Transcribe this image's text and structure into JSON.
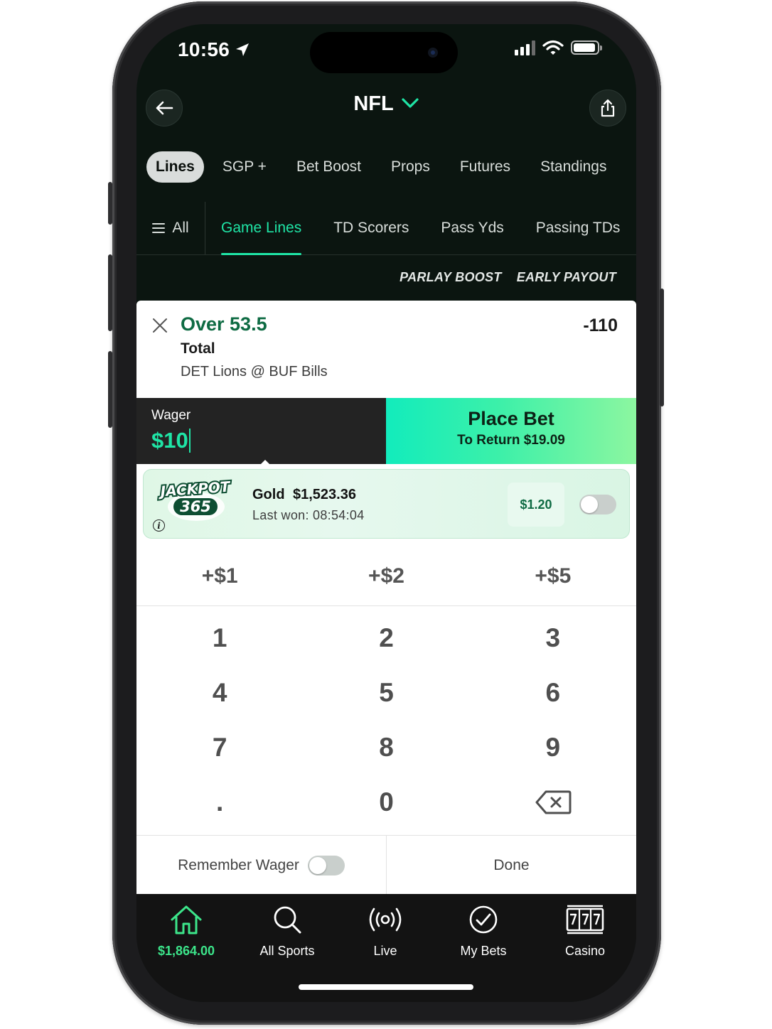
{
  "status": {
    "time": "10:56"
  },
  "header": {
    "title": "NFL"
  },
  "top_tabs": [
    {
      "label": "Lines",
      "active": true
    },
    {
      "label": "SGP +"
    },
    {
      "label": "Bet Boost"
    },
    {
      "label": "Props"
    },
    {
      "label": "Futures"
    },
    {
      "label": "Standings"
    }
  ],
  "sub_tabs": {
    "all": "All",
    "items": [
      {
        "label": "Game Lines",
        "active": true
      },
      {
        "label": "TD Scorers"
      },
      {
        "label": "Pass Yds"
      },
      {
        "label": "Passing TDs"
      }
    ]
  },
  "promos": [
    "PARLAY BOOST",
    "EARLY PAYOUT"
  ],
  "bet": {
    "selection": "Over 53.5",
    "odds": "-110",
    "market": "Total",
    "event": "DET Lions @ BUF Bills"
  },
  "wager": {
    "label": "Wager",
    "amount": "$10"
  },
  "place_bet": {
    "title": "Place Bet",
    "return": "To Return $19.09"
  },
  "jackpot": {
    "logo_text_top": "JACKPOT",
    "logo_text_bottom": "365",
    "tier": "Gold",
    "amount": "$1,523.36",
    "last_won": "Last won: 08:54:04",
    "price": "$1.20",
    "enabled": false
  },
  "quick_add": [
    "+$1",
    "+$2",
    "+$5"
  ],
  "keypad": [
    [
      "1",
      "2",
      "3"
    ],
    [
      "4",
      "5",
      "6"
    ],
    [
      "7",
      "8",
      "9"
    ],
    [
      ".",
      "0",
      "backspace-icon"
    ]
  ],
  "remember_wager": {
    "label": "Remember Wager",
    "enabled": false
  },
  "done_label": "Done",
  "tab_bar": [
    {
      "label": "$1,864.00",
      "icon": "home-icon",
      "active": true
    },
    {
      "label": "All Sports",
      "icon": "search-icon"
    },
    {
      "label": "Live",
      "icon": "live-broadcast-icon"
    },
    {
      "label": "My Bets",
      "icon": "check-circle-icon"
    },
    {
      "label": "Casino",
      "icon": "slot-machine-icon"
    }
  ],
  "colors": {
    "accent": "#1fe5a6",
    "header_bg": "#0b1510",
    "bet_green": "#0e6b43",
    "tab_active": "#3ce58a"
  }
}
